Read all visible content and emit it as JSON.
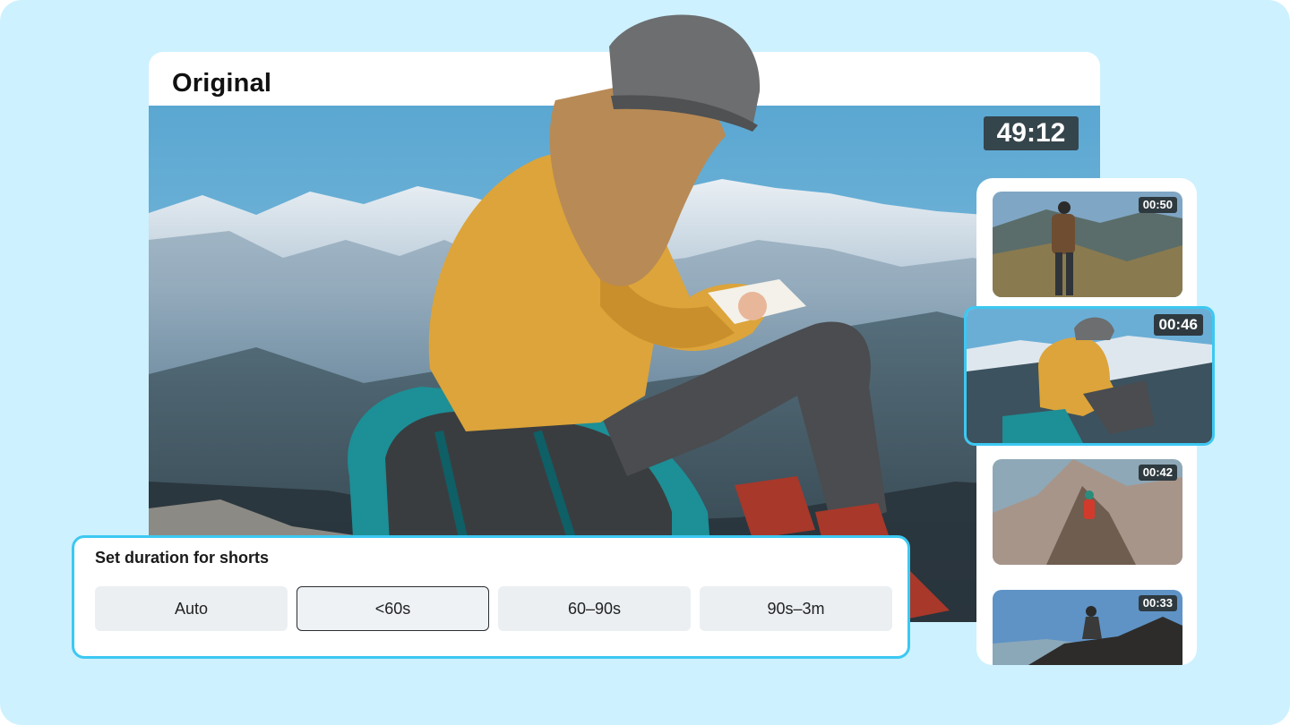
{
  "video": {
    "title": "Original",
    "timer": "49:12"
  },
  "shorts": [
    {
      "duration": "00:50",
      "subject": "hiker standing on mountain trail"
    },
    {
      "duration": "00:46",
      "subject": "hiker writing on mountain rock",
      "selected": true
    },
    {
      "duration": "00:42",
      "subject": "climber on rocky ridge"
    },
    {
      "duration": "00:33",
      "subject": "climber on boulders"
    }
  ],
  "duration_picker": {
    "title": "Set duration for shorts",
    "options": [
      "Auto",
      "<60s",
      "60–90s",
      "90s–3m"
    ],
    "selected": "<60s"
  },
  "colors": {
    "background": "#cdf1fe",
    "accent": "#3cc8f2",
    "badge": "#35454c"
  }
}
